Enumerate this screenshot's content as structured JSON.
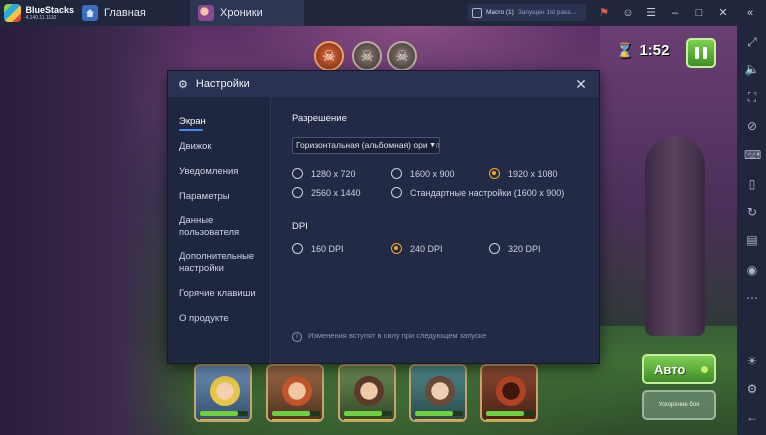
{
  "topbar": {
    "app_name": "BlueStacks",
    "app_version": "4.140.11.1110",
    "tabs": [
      {
        "label": "Главная"
      },
      {
        "label": "Хроники"
      }
    ],
    "macro": {
      "name": "Macro (1)",
      "status": "Запущен 1st pass..."
    }
  },
  "game": {
    "timer": "1:52",
    "auto_label": "Авто",
    "speed_label": "Ускорение боя"
  },
  "dialog": {
    "title": "Настройки",
    "nav": [
      {
        "label": "Экран",
        "active": true
      },
      {
        "label": "Движок"
      },
      {
        "label": "Уведомления"
      },
      {
        "label": "Параметры"
      },
      {
        "label": "Данные пользователя"
      },
      {
        "label": "Дополнительные настройки"
      },
      {
        "label": "Горячие клавиши"
      },
      {
        "label": "О продукте"
      }
    ],
    "resolution": {
      "title": "Разрешение",
      "orientation_selected": "Горизонтальная (альбомная) ориентация",
      "options": [
        {
          "label": "1280 x 720",
          "selected": false
        },
        {
          "label": "1600 x 900",
          "selected": false
        },
        {
          "label": "1920 x 1080",
          "selected": true
        },
        {
          "label": "2560 x 1440",
          "selected": false
        },
        {
          "label": "Стандартные настройки (1600 x 900)",
          "selected": false
        }
      ]
    },
    "dpi": {
      "title": "DPI",
      "options": [
        {
          "label": "160 DPI",
          "selected": false
        },
        {
          "label": "240 DPI",
          "selected": true
        },
        {
          "label": "320 DPI",
          "selected": false
        }
      ]
    },
    "note": "Изменения вступят в силу при следующем запуске"
  },
  "icons": {
    "sidebar": [
      "expand-icon",
      "volume-icon",
      "screenshot-icon",
      "eraser-icon",
      "keyboard-icon",
      "phone-icon",
      "rotate-icon",
      "media-icon",
      "camera-icon",
      "more-icon",
      "light-icon",
      "settings-icon",
      "back-icon"
    ]
  },
  "colors": {
    "accent": "#3b8df5",
    "radio_selected": "#f5a623",
    "dialog_bg": "#232a45"
  }
}
